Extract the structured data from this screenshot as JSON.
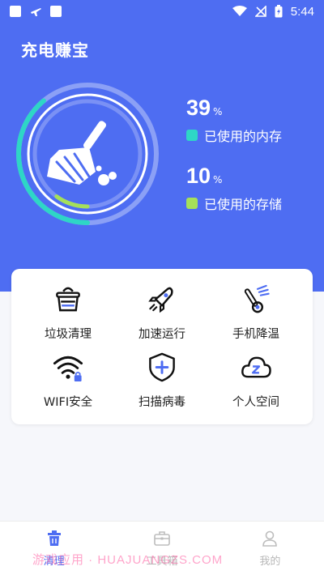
{
  "status_bar": {
    "time": "5:44",
    "icons": [
      "notification-square-icon",
      "airplane-mode-icon",
      "notification-square-icon",
      "wifi-icon",
      "no-sim-icon",
      "battery-charging-icon"
    ]
  },
  "header": {
    "title": "充电赚宝"
  },
  "gauge": {
    "icon": "broom-icon",
    "memory_fraction": 0.39,
    "storage_fraction": 0.1
  },
  "stats": {
    "memory": {
      "value": "39",
      "unit": "%",
      "label": "已使用的内存",
      "color": "#2ed6c6"
    },
    "storage": {
      "value": "10",
      "unit": "%",
      "label": "已使用的存储",
      "color": "#a5e05a"
    }
  },
  "tools": [
    {
      "label": "垃圾清理",
      "icon": "trash-basket-icon"
    },
    {
      "label": "加速运行",
      "icon": "rocket-icon"
    },
    {
      "label": "手机降温",
      "icon": "thermometer-icon"
    },
    {
      "label": "WIFI安全",
      "icon": "wifi-lock-icon"
    },
    {
      "label": "扫描病毒",
      "icon": "shield-plus-icon"
    },
    {
      "label": "个人空间",
      "icon": "cloud-icon"
    }
  ],
  "tabbar": {
    "tabs": [
      {
        "label": "清理",
        "icon": "trash-icon",
        "active": true
      },
      {
        "label": "工具箱",
        "icon": "toolbox-icon",
        "active": false
      },
      {
        "label": "我的",
        "icon": "user-icon",
        "active": false
      }
    ]
  },
  "watermark": "游戏应用 · HUAJUANGZS.COM",
  "colors": {
    "primary": "#4e6df2",
    "accent_memory": "#2ed6c6",
    "accent_storage": "#a5e05a",
    "background": "#f6f7fb"
  }
}
